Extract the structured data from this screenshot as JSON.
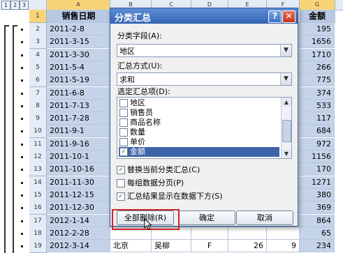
{
  "levels": [
    "1",
    "2",
    "3"
  ],
  "columns": [
    "A",
    "B",
    "C",
    "D",
    "E",
    "F",
    "G"
  ],
  "sheet": {
    "header": {
      "row": "1",
      "a": "销售日期",
      "g": "金额"
    },
    "rows": [
      {
        "row": "2",
        "date": "2011-2-8",
        "amount": "195"
      },
      {
        "row": "3",
        "date": "2011-3-15",
        "amount": "1656"
      },
      {
        "row": "4",
        "date": "2011-3-30",
        "amount": "1710"
      },
      {
        "row": "5",
        "date": "2011-5-4",
        "amount": "266"
      },
      {
        "row": "6",
        "date": "2011-5-19",
        "amount": "775"
      },
      {
        "row": "7",
        "date": "2011-6-8",
        "amount": "374"
      },
      {
        "row": "8",
        "date": "2011-7-13",
        "amount": "533"
      },
      {
        "row": "9",
        "date": "2011-7-28",
        "amount": "117"
      },
      {
        "row": "10",
        "date": "2011-9-1",
        "amount": "684"
      },
      {
        "row": "11",
        "date": "2011-9-16",
        "amount": "972"
      },
      {
        "row": "12",
        "date": "2011-10-1",
        "amount": "1156"
      },
      {
        "row": "13",
        "date": "2011-10-16",
        "amount": "170"
      },
      {
        "row": "14",
        "date": "2011-11-30",
        "amount": "1271"
      },
      {
        "row": "15",
        "date": "2011-12-15",
        "amount": "380"
      },
      {
        "row": "16",
        "date": "2011-12-30",
        "amount": "369"
      },
      {
        "row": "17",
        "date": "2012-1-14",
        "amount": "864"
      },
      {
        "row": "18",
        "date": "2012-2-28",
        "amount": "65"
      },
      {
        "row": "19",
        "date": "2012-3-14",
        "b": "北京",
        "c": "吴柳",
        "d": "F",
        "e": "26",
        "f": "9",
        "amount": "234"
      }
    ]
  },
  "dialog": {
    "title": "分类汇总",
    "help_label": "?",
    "close_label": "✕",
    "group_field_label": "分类字段(A):",
    "group_field_value": "地区",
    "func_label": "汇总方式(U):",
    "func_value": "求和",
    "items_label": "选定汇总项(D):",
    "items": [
      {
        "label": "地区",
        "checked": false
      },
      {
        "label": "销售员",
        "checked": false
      },
      {
        "label": "商品名称",
        "checked": false
      },
      {
        "label": "数量",
        "checked": false
      },
      {
        "label": "单价",
        "checked": false
      },
      {
        "label": "金额",
        "checked": true
      }
    ],
    "options": [
      {
        "label": "替换当前分类汇总(C)",
        "checked": true
      },
      {
        "label": "每组数据分页(P)",
        "checked": false
      },
      {
        "label": "汇总结果显示在数据下方(S)",
        "checked": true
      }
    ],
    "btn_remove_all": "全部删除(R)",
    "btn_ok": "确定",
    "btn_cancel": "取消"
  },
  "colors": {
    "highlight": "#d0242a",
    "titlebar": "#3465b3",
    "selected_col": "#c5d3e9"
  },
  "icons": [
    "dropdown-arrow-icon",
    "checkbox-icon",
    "close-icon",
    "help-icon",
    "cursor-icon",
    "scroll-arrow-icon"
  ]
}
